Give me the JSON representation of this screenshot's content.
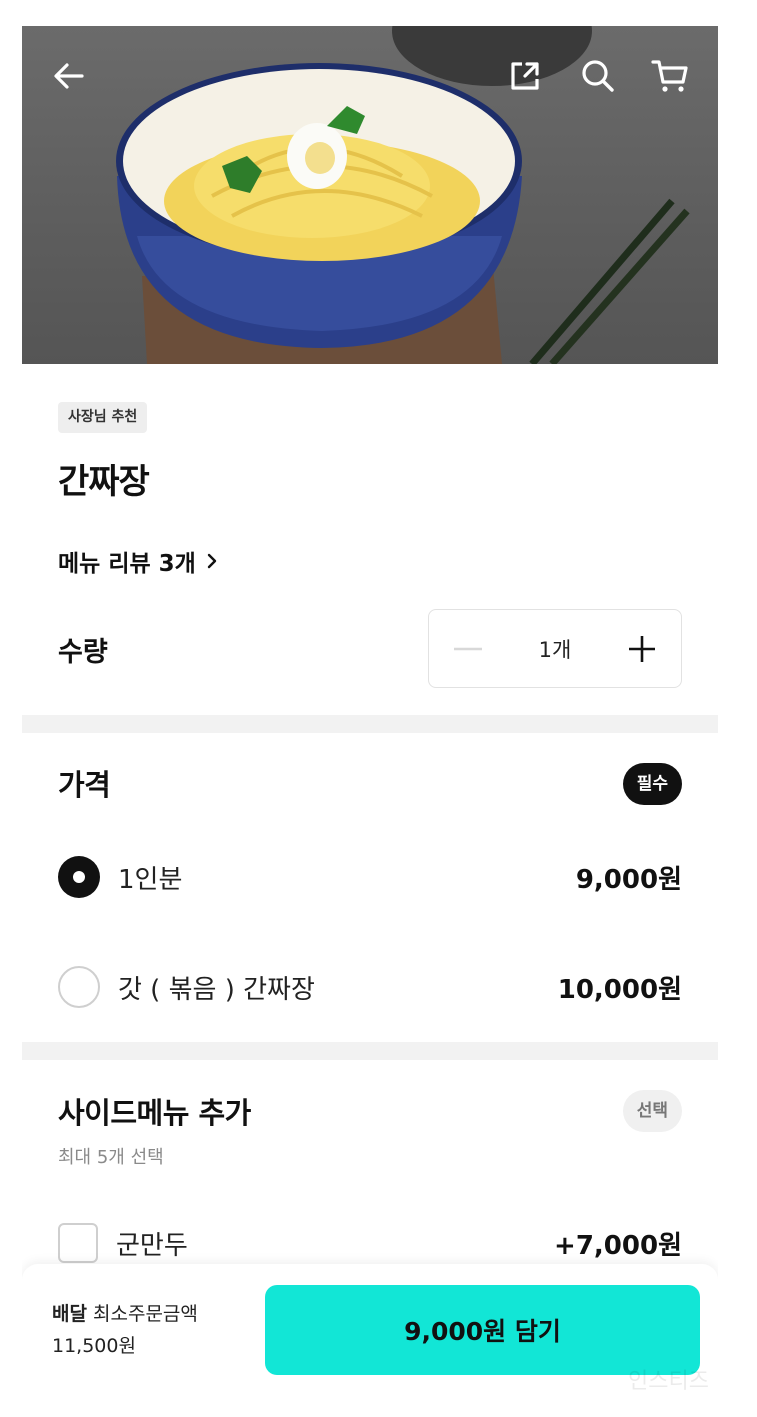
{
  "hero": {
    "back_icon": "arrow-left-icon",
    "share_icon": "share-icon",
    "search_icon": "search-icon",
    "cart_icon": "cart-icon"
  },
  "menu": {
    "badge": "사장님 추천",
    "title": "간짜장",
    "reviews_link": "메뉴 리뷰 3개",
    "quantity_label": "수량",
    "quantity_value": "1개"
  },
  "price_section": {
    "title": "가격",
    "tag": "필수",
    "options": [
      {
        "label": "1인분",
        "price": "9,000원",
        "selected": true
      },
      {
        "label": "갓 ( 볶음 ) 간짜장",
        "price": "10,000원",
        "selected": false
      }
    ]
  },
  "side_section": {
    "title": "사이드메뉴 추가",
    "tag": "선택",
    "note": "최대 5개 선택",
    "options": [
      {
        "label": "군만두",
        "price": "+7,000원",
        "checked": false
      }
    ]
  },
  "bottom_bar": {
    "delivery_label": "배달",
    "min_order_label": "최소주문금액",
    "min_order_value": "11,500원",
    "add_button_label": "9,000원 담기"
  },
  "watermark": "인스티즈",
  "colors": {
    "accent": "#12e6d6",
    "required_tag": "#111111",
    "divider": "#f2f2f2"
  }
}
